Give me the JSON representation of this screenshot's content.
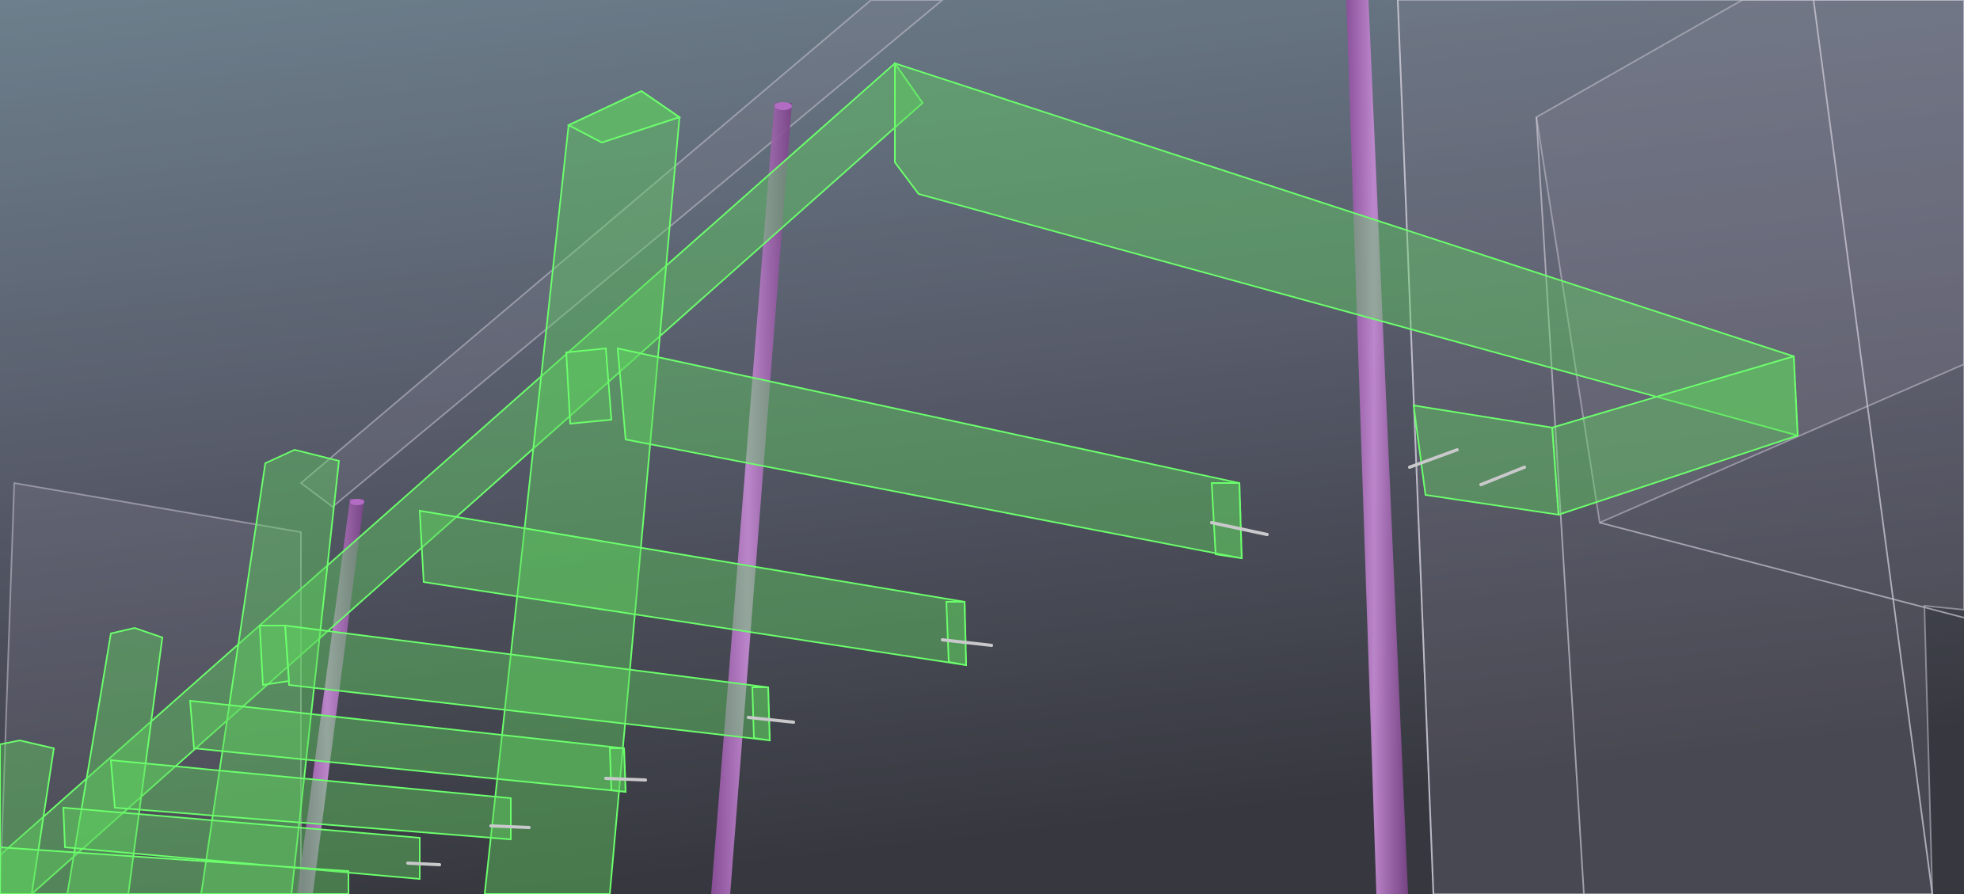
{
  "viewport": {
    "background_top": "#6d7f8c",
    "background_mid": "#575b6a",
    "background_bottom": "#37383f",
    "beam_fill": "#5fd35f",
    "beam_stroke": "#6cff6c",
    "pipe_color": "#b36cc4",
    "wall_fill": "#8a8596",
    "wall_stroke": "#c8c4d2",
    "bolt_color": "#c9c9cc"
  }
}
